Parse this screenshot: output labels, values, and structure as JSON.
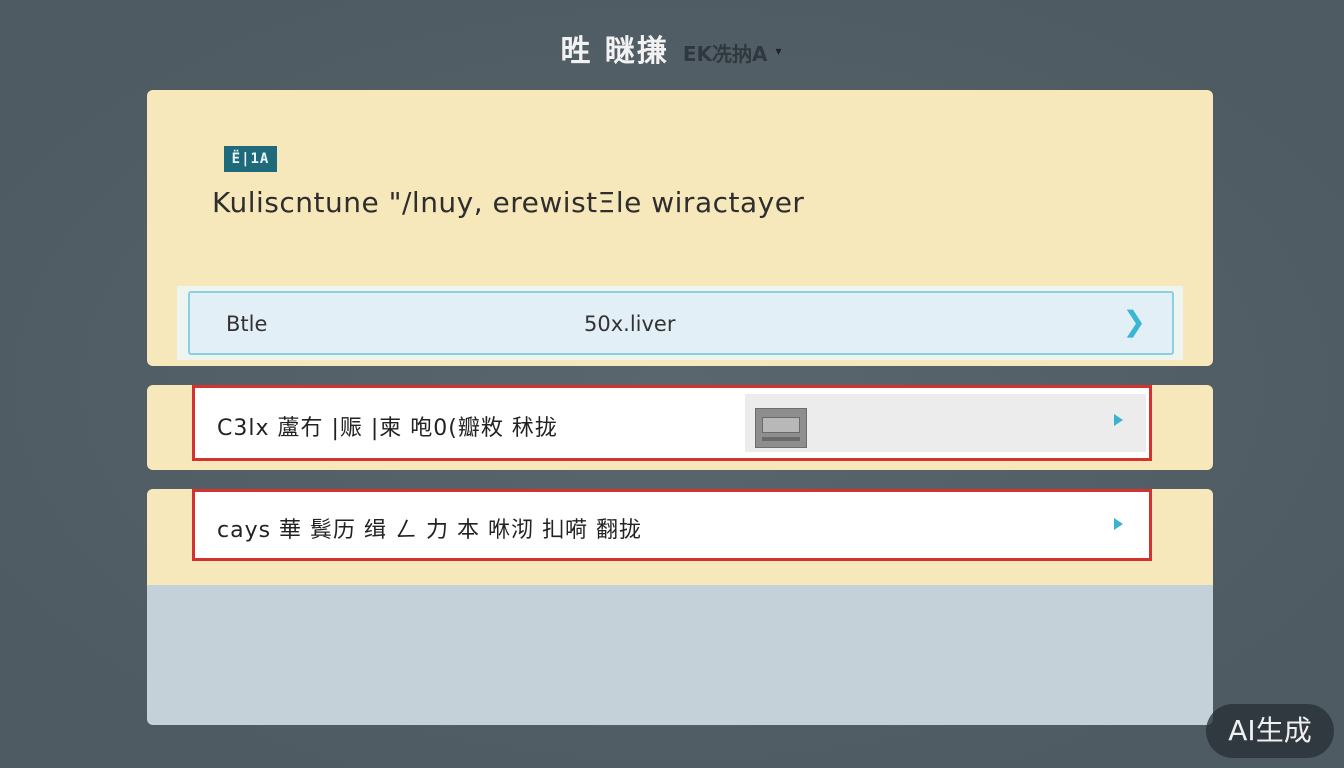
{
  "header": {
    "title": "甠 瞇搛",
    "subtitle": "EK冼抐A",
    "caret": "▾"
  },
  "card": {
    "logo_text": "Ë|1A",
    "headline": "Kulisсntune \"/lnuy, erewistΞle wiractayer"
  },
  "selector": {
    "label": "Btle",
    "value": "50x.liver",
    "chevron": "❯"
  },
  "rows": [
    {
      "text": "C3lx 蘆冇 |赈 |柬 咆0(瓣敉 秫拢",
      "has_thumbnail": true
    },
    {
      "text": "cays 華 鬂历 缉 ㄥ 力 本 咻沏 㧄嗬 翻拢"
    }
  ],
  "badge": {
    "label": "AI生成"
  },
  "colors": {
    "background": "#536068",
    "panel": "#f7e8bb",
    "selector_border": "#8ccfe0",
    "row_border": "#d4322f",
    "accent": "#38b6d3"
  }
}
